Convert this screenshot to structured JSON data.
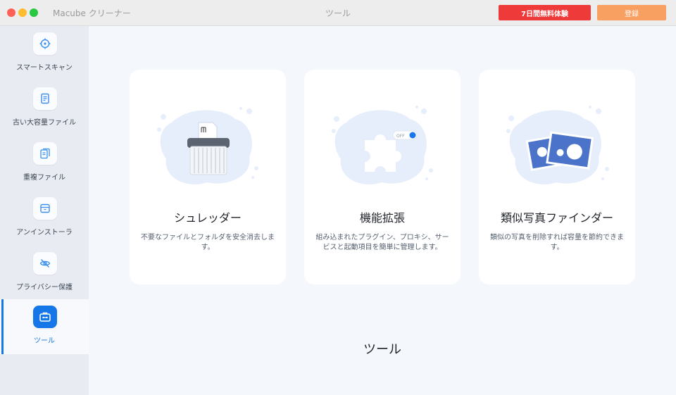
{
  "window": {
    "app_title": "Macube クリーナー",
    "title": "ツール",
    "trial_button": "7日間無料体験",
    "register_button": "登録"
  },
  "sidebar": {
    "items": [
      {
        "label": "スマートスキャン",
        "icon": "crosshair-icon",
        "active": false
      },
      {
        "label": "古い大容量ファイル",
        "icon": "document-icon",
        "active": false
      },
      {
        "label": "重複ファイル",
        "icon": "duplicate-files-icon",
        "active": false
      },
      {
        "label": "アンインストーラ",
        "icon": "box-icon",
        "active": false
      },
      {
        "label": "プライバシー保護",
        "icon": "eye-off-icon",
        "active": false
      },
      {
        "label": "ツール",
        "icon": "toolbox-icon",
        "active": true
      }
    ]
  },
  "main": {
    "cards": [
      {
        "title": "シュレッダー",
        "description": "不要なファイルとフォルダを安全消去します。",
        "icon": "shredder-icon"
      },
      {
        "title": "機能拡張",
        "description": "組み込まれたプラグイン、プロキシ、サービスと起動項目を簡単に管理します。",
        "icon": "puzzle-icon",
        "toggle_label": "OFF"
      },
      {
        "title": "類似写真ファインダー",
        "description": "類似の写真を削除すれば容量を節約できます。",
        "icon": "photos-icon"
      }
    ],
    "section_title": "ツール"
  },
  "colors": {
    "accent": "#1677e8",
    "trial": "#ef3a3a",
    "register": "#f7a061",
    "sidebar_bg": "#e8ecf2",
    "main_bg": "#f4f7fc"
  }
}
